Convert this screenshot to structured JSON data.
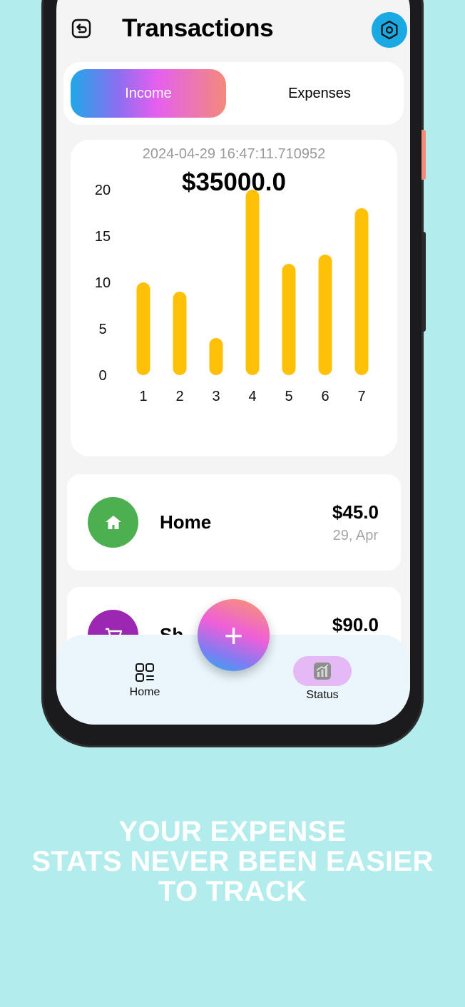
{
  "header": {
    "title": "Transactions"
  },
  "tabs": {
    "income_label": "Income",
    "expenses_label": "Expenses"
  },
  "summary": {
    "timestamp": "2024-04-29 16:47:11.710952",
    "total": "$35000.0"
  },
  "chart_data": {
    "type": "bar",
    "categories": [
      "1",
      "2",
      "3",
      "4",
      "5",
      "6",
      "7"
    ],
    "values": [
      10,
      9,
      4,
      20,
      12,
      13,
      18
    ],
    "y_ticks": [
      "0",
      "5",
      "10",
      "15",
      "20"
    ],
    "ylim": [
      0,
      20
    ],
    "bar_color": "#ffc107",
    "grid": false
  },
  "transactions": [
    {
      "name": "Home",
      "amount": "$45.0",
      "date": "29, Apr",
      "color": "#4caf50",
      "icon": "home-icon"
    },
    {
      "name": "Sh",
      "amount": "$90.0",
      "date": "",
      "color": "#9c27b0",
      "icon": "cart-icon"
    }
  ],
  "bottom_nav": {
    "home_label": "Home",
    "status_label": "Status"
  },
  "fab": {
    "label": "+"
  },
  "tagline": {
    "line1": "YOUR EXPENSE",
    "line2": "STATS NEVER BEEN EASIER",
    "line3": "TO TRACK"
  },
  "colors": {
    "background": "#b2ecec",
    "accent": "#1aa9e3",
    "income_gradient": [
      "#1fa7e9",
      "#e45ff0",
      "#f38a7b"
    ],
    "nav_active": "#e4b9f4"
  }
}
